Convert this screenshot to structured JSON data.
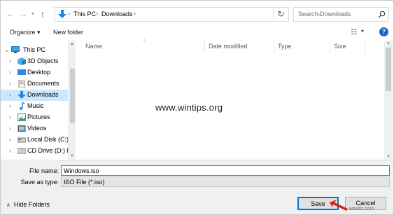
{
  "address": {
    "crumbs": [
      "This PC",
      "Downloads"
    ],
    "search_placeholder": "Search Downloads"
  },
  "toolbar": {
    "organize_label": "Organize",
    "new_folder_label": "New folder"
  },
  "nav": {
    "items": [
      {
        "label": "This PC",
        "icon": "pc-icon"
      },
      {
        "label": "3D Objects",
        "icon": "cube-icon"
      },
      {
        "label": "Desktop",
        "icon": "desktop-icon"
      },
      {
        "label": "Documents",
        "icon": "documents-icon"
      },
      {
        "label": "Downloads",
        "icon": "download-icon"
      },
      {
        "label": "Music",
        "icon": "music-icon"
      },
      {
        "label": "Pictures",
        "icon": "pictures-icon"
      },
      {
        "label": "Videos",
        "icon": "videos-icon"
      },
      {
        "label": "Local Disk (C:)",
        "icon": "disk-icon"
      },
      {
        "label": "CD Drive (D:) ESI",
        "icon": "cd-drive-icon"
      }
    ]
  },
  "columns": [
    "Name",
    "Date modified",
    "Type",
    "Size"
  ],
  "watermark": "www.wintips.org",
  "form": {
    "file_name_label": "File name:",
    "file_name_value": "Windows.iso",
    "save_type_label": "Save as type:",
    "save_type_value": "ISO File (*.iso)"
  },
  "footer": {
    "hide_folders_label": "Hide Folders",
    "save_label": "Save",
    "cancel_label": "Cancel",
    "brand": "wsxdn.com"
  },
  "colors": {
    "accent": "#0078d7",
    "selection": "#cce8ff",
    "arrow": "#d9261c"
  }
}
